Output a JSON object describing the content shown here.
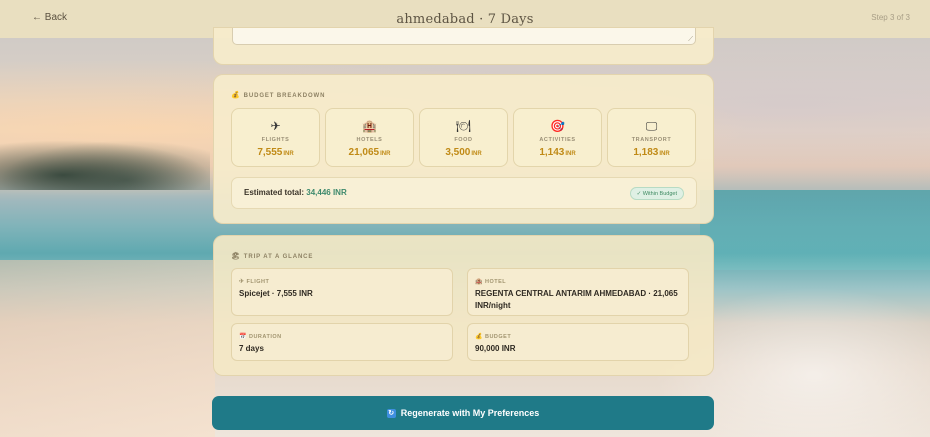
{
  "header": {
    "back_label": "← Back",
    "title": "ahmedabad · 7 Days",
    "step": "Step 3 of 3"
  },
  "budget": {
    "section_icon": "money-bag-icon",
    "section_label": "BUDGET BREAKDOWN",
    "categories": [
      {
        "icon": "airplane-icon",
        "glyph": "✈",
        "label": "FLIGHTS",
        "amount": "7,555",
        "unit": "INR"
      },
      {
        "icon": "hotel-icon",
        "glyph": "🏨",
        "label": "HOTELS",
        "amount": "21,065",
        "unit": "INR"
      },
      {
        "icon": "food-icon",
        "glyph": "🍽",
        "label": "FOOD",
        "amount": "3,500",
        "unit": "INR"
      },
      {
        "icon": "target-icon",
        "glyph": "🎯",
        "label": "ACTIVITIES",
        "amount": "1,143",
        "unit": "INR"
      },
      {
        "icon": "transport-icon",
        "glyph": "🖵",
        "label": "TRANSPORT",
        "amount": "1,183",
        "unit": "INR"
      }
    ],
    "total_label": "Estimated total:",
    "total_value": "34,446 INR",
    "status_badge": "✓ Within Budget"
  },
  "glance": {
    "section_label": "TRIP AT A GLANCE",
    "tiles": {
      "flight": {
        "label": "FLIGHT",
        "value": "Spicejet · 7,555 INR"
      },
      "hotel": {
        "label": "HOTEL",
        "value": "REGENTA CENTRAL ANTARIM AHMEDABAD · 21,065 INR/night"
      },
      "duration": {
        "label": "DURATION",
        "value": "7 days"
      },
      "budget": {
        "label": "BUDGET",
        "value": "90,000 INR"
      }
    }
  },
  "actions": {
    "regenerate_label": "Regenerate with My Preferences"
  },
  "colors": {
    "accent_teal": "#1f7a88",
    "amount_gold": "#c08a16",
    "total_green": "#3e8a6d"
  }
}
